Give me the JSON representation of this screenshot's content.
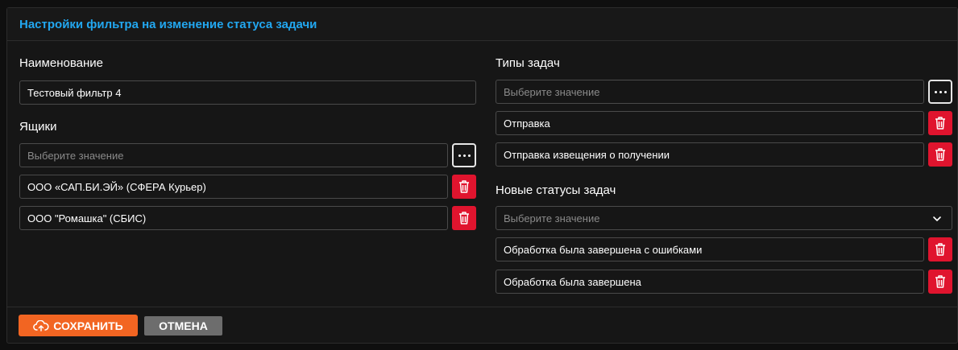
{
  "header": {
    "title": "Настройки фильтра на изменение статуса задачи"
  },
  "name_section": {
    "label": "Наименование",
    "value": "Тестовый фильтр 4"
  },
  "boxes_section": {
    "label": "Ящики",
    "placeholder": "Выберите значение",
    "items": [
      "ООО «САП.БИ.ЭЙ» (СФЕРА Курьер)",
      "ООО \"Ромашка\" (СБИС)"
    ]
  },
  "task_types_section": {
    "label": "Типы задач",
    "placeholder": "Выберите значение",
    "items": [
      "Отправка",
      "Отправка извещения о получении"
    ]
  },
  "statuses_section": {
    "label": "Новые статусы задач",
    "placeholder": "Выберите значение",
    "items": [
      "Обработка была завершена с ошибками",
      "Обработка была завершена"
    ]
  },
  "footer": {
    "save_label": "СОХРАНИТЬ",
    "cancel_label": "ОТМЕНА"
  },
  "colors": {
    "accent": "#22a7f0",
    "save": "#f26522",
    "delete": "#e0142e",
    "cancel": "#6d6d6d"
  },
  "icons": {
    "select_more": "more-dots-icon",
    "delete": "trash-icon",
    "dropdown": "chevron-down-icon",
    "save": "cloud-upload-icon"
  }
}
